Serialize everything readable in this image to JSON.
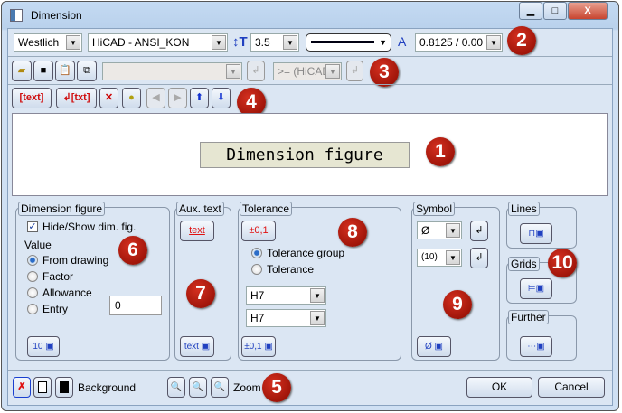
{
  "window": {
    "title": "Dimension",
    "minimize": "▁",
    "maximize": "□",
    "close": "X"
  },
  "toolbar1": {
    "font": "Westlich",
    "standard": "HiCAD - ANSI_KON",
    "text_height": "3.5",
    "line_style": "solid",
    "ratio": "0.8125 / 0.00"
  },
  "toolbar2": {
    "combo_value": "",
    ">=_label": ">= (HiCAD",
    "compare_value": ">= (HiCAD"
  },
  "toolbar3": {
    "text_btn": "[text]",
    "newline_txt_btn": "↲[txt]"
  },
  "preview": {
    "text": "Dimension figure"
  },
  "groups": {
    "dim_figure": {
      "title": "Dimension figure",
      "hide_show": "Hide/Show dim. fig.",
      "checked": true,
      "value_label": "Value",
      "options": [
        "From drawing",
        "Factor",
        "Allowance",
        "Entry"
      ],
      "selected": "From drawing",
      "entry_value": "0",
      "btn": "10"
    },
    "aux_text": {
      "title": "Aux. text",
      "btn_top": "text",
      "btn_bottom": "text"
    },
    "tolerance": {
      "title": "Tolerance",
      "btn_top": "±0,1",
      "options": [
        "Tolerance group",
        "Tolerance"
      ],
      "selected": "Tolerance group",
      "select1": "H7",
      "select2": "H7",
      "btn_bottom": "±0,1"
    },
    "symbol": {
      "title": "Symbol",
      "select1": "Ø",
      "select2": "(10)",
      "btn": "Ø"
    },
    "lines": {
      "title": "Lines"
    },
    "grids": {
      "title": "Grids"
    },
    "further": {
      "title": "Further"
    }
  },
  "bottom": {
    "background_label": "Background",
    "zoom_label": "Zoom",
    "ok": "OK",
    "cancel": "Cancel"
  },
  "badges": [
    "1",
    "2",
    "3",
    "4",
    "5",
    "6",
    "7",
    "8",
    "9",
    "10"
  ],
  "colors": {
    "badge": "#b01a0a",
    "panel": "#dbe6f3",
    "preview_fill": "#e6e6d2"
  }
}
